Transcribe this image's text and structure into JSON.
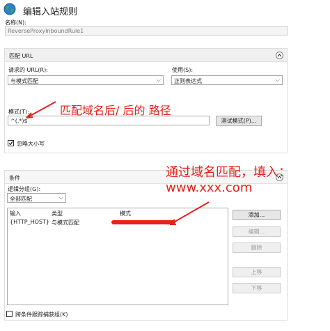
{
  "window": {
    "title": "编辑入站规则"
  },
  "name_field": {
    "label": "名称(N):",
    "value": "ReverseProxyInboundRule1"
  },
  "match_url": {
    "header": "匹配 URL",
    "requested_url_label": "请求的 URL(R):",
    "requested_url_value": "与模式匹配",
    "using_label": "使用(S):",
    "using_value": "正则表达式",
    "pattern_label": "模式(T):",
    "pattern_value": "^(.*)$",
    "test_button": "测试模式(P)...",
    "ignore_case_label": "忽略大小写",
    "ignore_case_checked": true
  },
  "conditions": {
    "header": "条件",
    "grouping_label": "逻辑分组(G):",
    "grouping_value": "全部匹配",
    "columns": [
      "输入",
      "类型",
      "模式"
    ],
    "rows": [
      {
        "input": "{HTTP_HOST}",
        "type": "与模式匹配",
        "pattern": ""
      }
    ],
    "buttons": {
      "add": "添加...",
      "edit": "编辑...",
      "delete": "删除",
      "move_up": "上移",
      "move_down": "下移"
    },
    "track_groups_label": "跨条件跟踪捕获组(K)",
    "track_groups_checked": false
  },
  "annotations": {
    "pattern_note": "匹配域名后/ 后的 路径",
    "conditions_note_line1": "通过域名匹配，填入：",
    "conditions_note_line2": "www.xxx.com",
    "color": "#e8211a"
  },
  "icons": {
    "globe": "globe-icon",
    "collapse": "chevron-up-icon",
    "dropdown": "chevron-down-icon"
  }
}
